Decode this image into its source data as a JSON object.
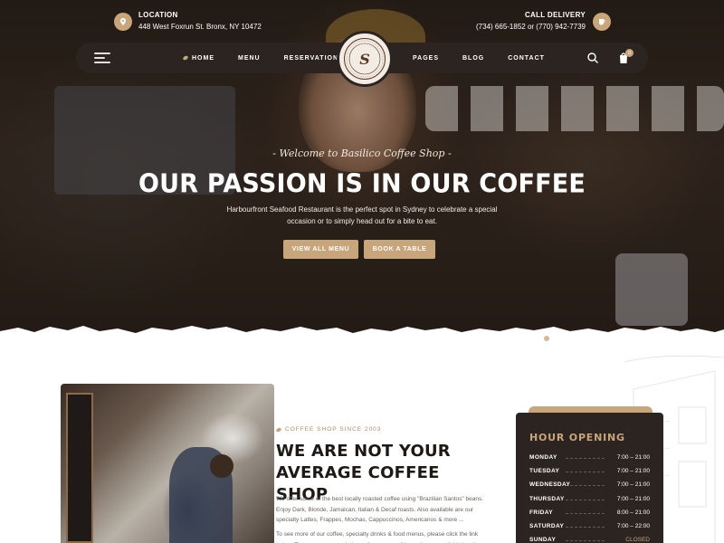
{
  "top_info": {
    "location_label": "LOCATION",
    "location_value": "448 West Foxrun St. Bronx, NY 10472",
    "delivery_label": "CALL DELIVERY",
    "delivery_value": "(734) 665-1852 or (770) 942-7739"
  },
  "nav": {
    "left_items": [
      "HOME",
      "MENU",
      "RESERVATION"
    ],
    "right_items": [
      "PAGES",
      "BLOG",
      "CONTACT"
    ],
    "cart_count": "0"
  },
  "hero": {
    "welcome": "- Welcome to Basilico Coffee Shop -",
    "headline": "OUR PASSION IS IN OUR COFFEE",
    "description": "Harbourfront Seafood Restaurant is the perfect spot in Sydney to celebrate a special occasion or to simply head out for a bite to eat.",
    "btn_menu": "VIEW ALL MENU",
    "btn_table": "BOOK A TABLE"
  },
  "about": {
    "eyebrow": "COFFEE SHOP SINCE 2003",
    "title": "WE ARE NOT YOUR AVERAGE COFFEE SHOP",
    "p1": "We offer some of the best locally roasted coffee using \"Brazilian Santos\" beans. Enjoy Dark, Blonde, Jamaican, Italian & Decaf roasts. Also available are our specialty Lattes, Frappes, Mochas, Cappuccinos, Americanos & more ...",
    "p2": "To see more of our coffee, specialty drinks & food menus, please click the link below. There are many variations of passages of lorem ipsum available but the"
  },
  "hours": {
    "title": "HOUR OPENING",
    "rows": [
      {
        "day": "MONDAY",
        "time": "7:00 – 21:00"
      },
      {
        "day": "TUESDAY",
        "time": "7:00 – 21:00"
      },
      {
        "day": "WEDNESDAY",
        "time": "7:00 – 21:00"
      },
      {
        "day": "THURSDAY",
        "time": "7:00 – 21:00"
      },
      {
        "day": "FRIDAY",
        "time": "8:00 – 21:00"
      },
      {
        "day": "SATURDAY",
        "time": "7:00 – 22:00"
      },
      {
        "day": "SUNDAY",
        "time": "CLOSED"
      }
    ]
  },
  "colors": {
    "accent": "#c9a57c",
    "dark": "#2c2420",
    "text_dark": "#1e1915"
  },
  "icons": {
    "location": "map-pin-icon",
    "delivery": "coffee-cup-icon",
    "menu": "hamburger-icon",
    "search": "search-icon",
    "cart": "shopping-bag-icon"
  }
}
